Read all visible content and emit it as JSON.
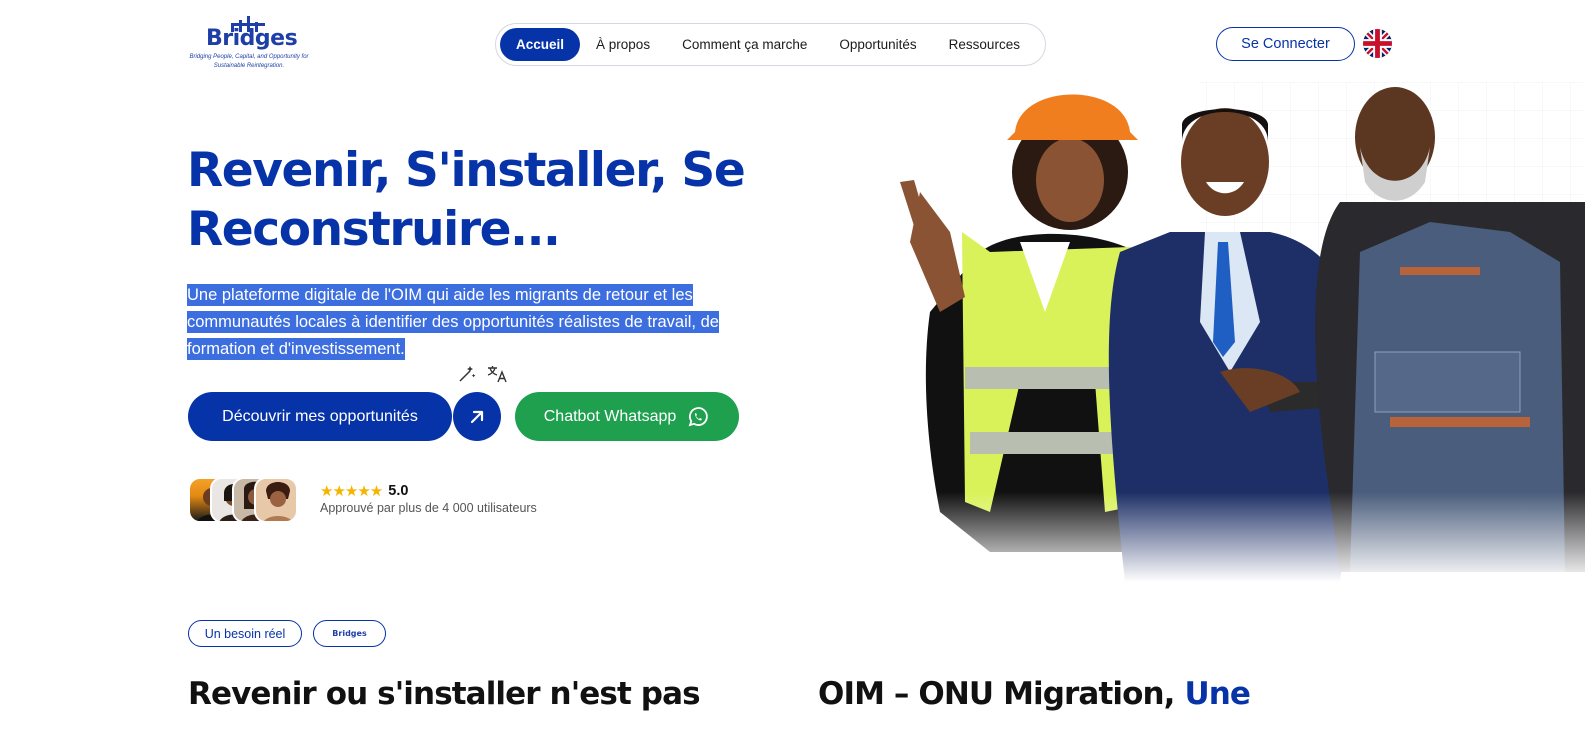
{
  "brand": {
    "name": "Bridges",
    "tagline": "Bridging People, Capital, and Opportunity for Sustainable Reintegration."
  },
  "nav": {
    "items": [
      {
        "label": "Accueil",
        "active": true
      },
      {
        "label": "À propos",
        "active": false
      },
      {
        "label": "Comment ça marche",
        "active": false
      },
      {
        "label": "Opportunités",
        "active": false
      },
      {
        "label": "Ressources",
        "active": false
      }
    ],
    "login_label": "Se Connecter",
    "language_icon": "uk-flag-icon"
  },
  "hero": {
    "title": "Revenir, S'installer, Se Reconstruire...",
    "description": "Une plateforme digitale de l'OIM qui aide les migrants de retour et les communautés locales à identifier des opportunités réalistes de travail, de formation et d'investissement.",
    "discover_label": "Découvrir mes opportunités",
    "whatsapp_label": "Chatbot Whatsapp",
    "rating_value": "5.0",
    "rating_stars": 5,
    "approved_text": "Approuvé par plus de 4 000 utilisateurs"
  },
  "section": {
    "pill_label": "Un besoin réel",
    "title_left": "Revenir ou s'installer n'est pas",
    "title_right_main": "OIM – ONU Migration, ",
    "title_right_accent": "Une"
  },
  "colors": {
    "primary": "#0633a8",
    "whatsapp": "#1ea04f",
    "selection": "#3d6ee0",
    "star": "#f5b400"
  }
}
